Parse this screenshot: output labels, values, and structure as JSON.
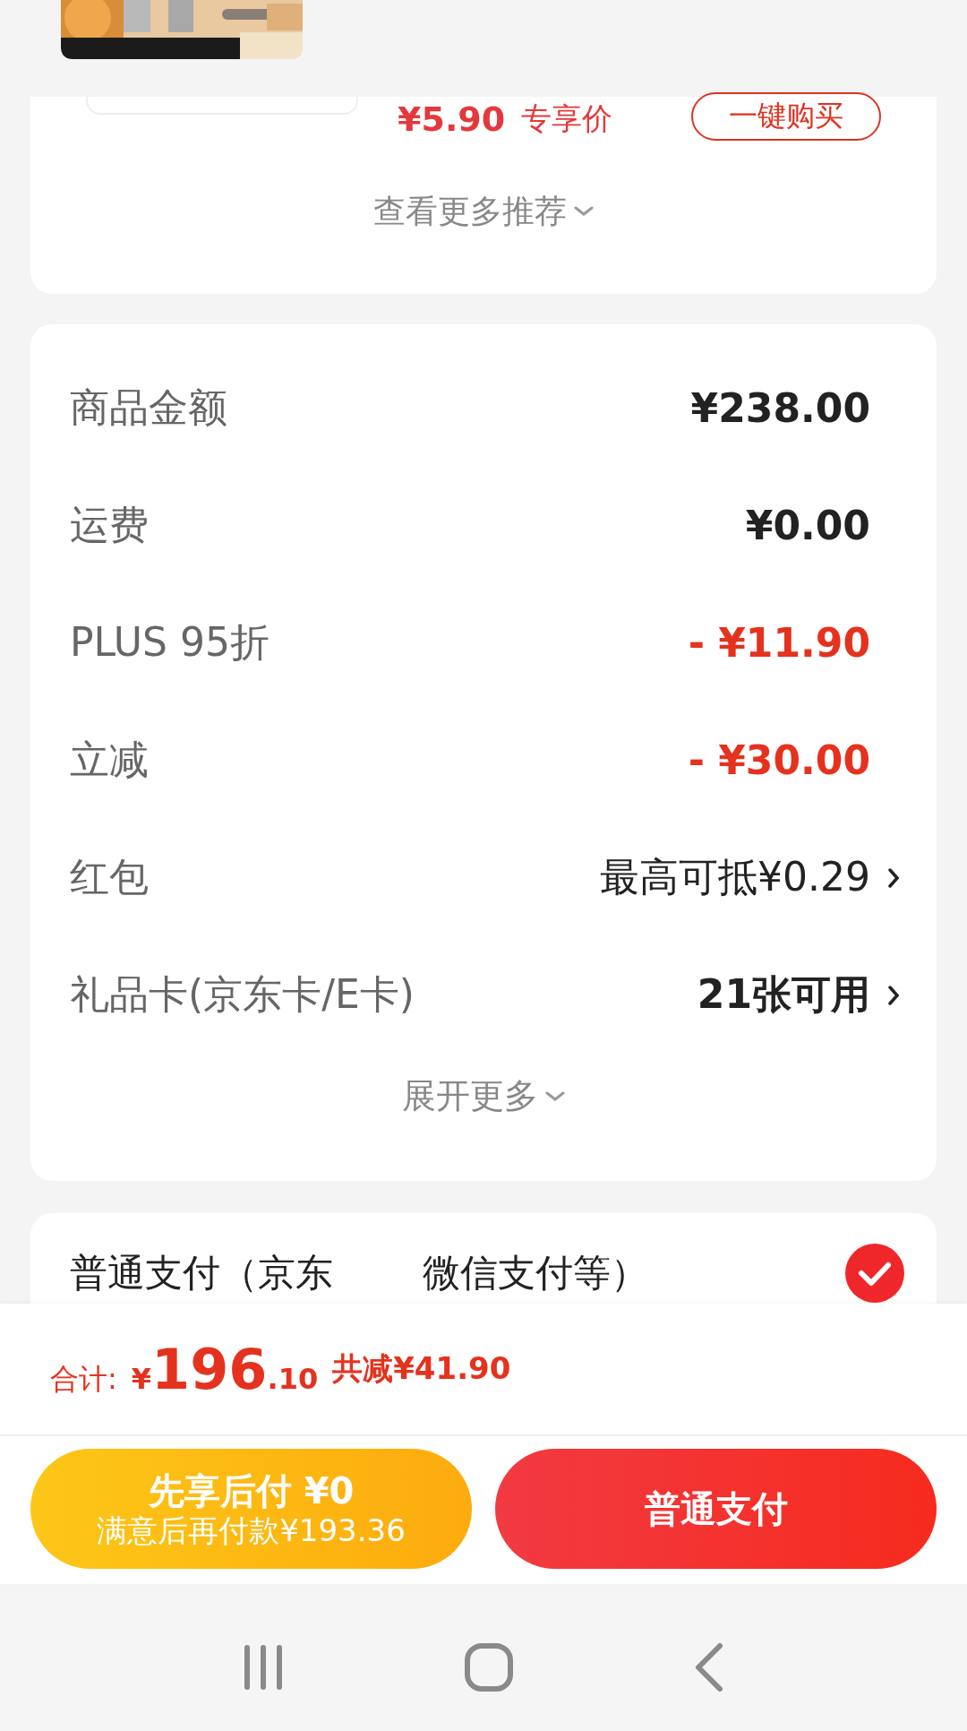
{
  "recommendation": {
    "price": "¥5.90",
    "price_label": "专享价",
    "buy_button": "一键购买",
    "more_link": "查看更多推荐"
  },
  "summary": {
    "rows": [
      {
        "label": "商品金额",
        "value": "¥238.00",
        "kind": "amount"
      },
      {
        "label": "运费",
        "value": "¥0.00",
        "kind": "amount"
      },
      {
        "label": "PLUS 95折",
        "value": "- ¥11.90",
        "kind": "discount"
      },
      {
        "label": "立减",
        "value": "- ¥30.00",
        "kind": "discount"
      },
      {
        "label": "红包",
        "value": "最高可抵¥0.29",
        "kind": "link"
      },
      {
        "label": "礼品卡(京东卡/E卡)",
        "value": "21张可用",
        "kind": "link"
      }
    ],
    "expand_link": "展开更多"
  },
  "payment_option": {
    "label_start": "普通支付（京东",
    "label_end": "微信支付等）",
    "selected": true
  },
  "total": {
    "label": "合计:",
    "currency": "¥",
    "integer": "196",
    "decimal": ".10",
    "savings": "共减¥41.90"
  },
  "buttons": [
    {
      "kind": "later",
      "title": "先享后付 ¥0",
      "subtitle": "满意后再付款¥193.36"
    },
    {
      "kind": "normal",
      "title": "普通支付"
    }
  ]
}
